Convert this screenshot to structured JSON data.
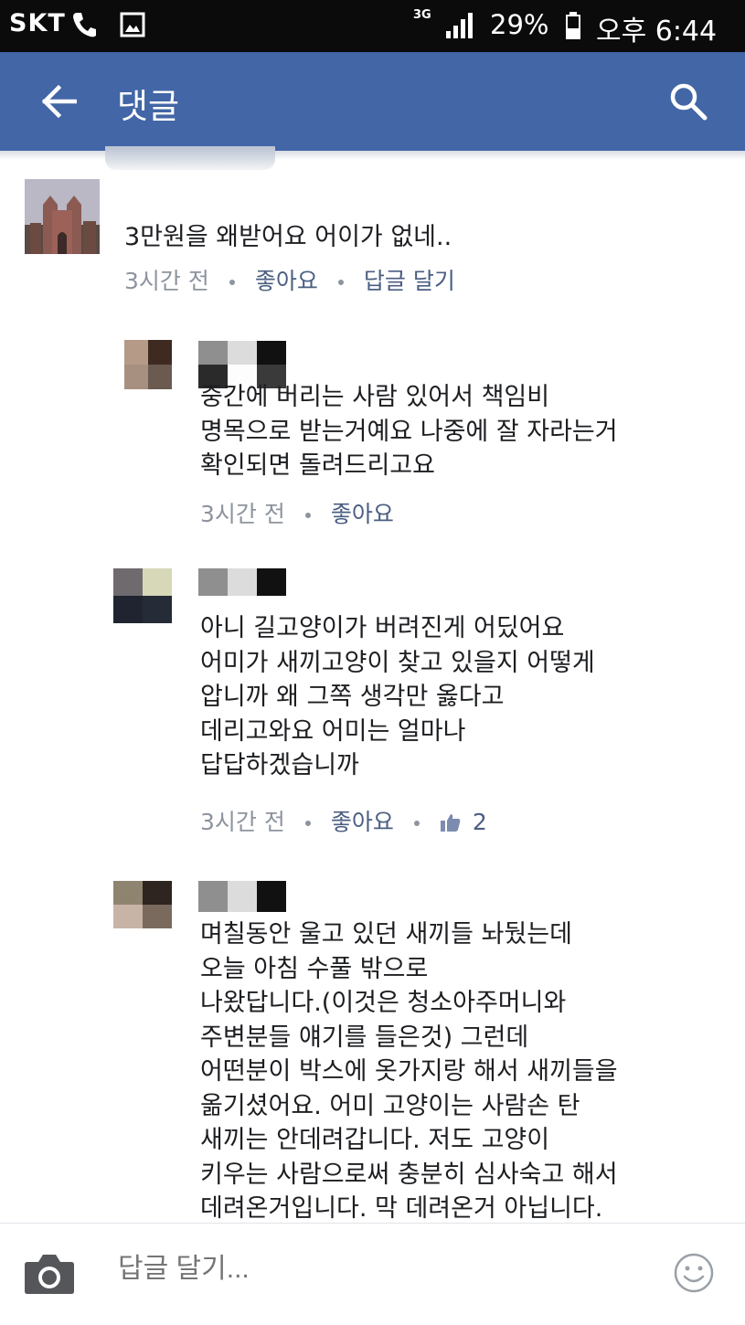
{
  "status_bar": {
    "carrier": "SKT",
    "network": "3G",
    "battery_percent": "29%",
    "time": "오후 6:44",
    "icons": [
      "phone-icon",
      "gallery-icon",
      "signal-icon",
      "battery-icon"
    ]
  },
  "app_bar": {
    "title": "댓글",
    "back_icon": "back-arrow-icon",
    "search_icon": "search-icon",
    "background": "#4266a6"
  },
  "comments": [
    {
      "text": "3만원을 왜받어요 어이가 없네..",
      "time": "3시간 전",
      "like_label": "좋아요",
      "reply_label": "답글 달기"
    },
    {
      "text": "중간에 버리는 사람 있어서 책임비\n명목으로 받는거예요 나중에 잘 자라는거\n확인되면 돌려드리고요",
      "time": "3시간 전",
      "like_label": "좋아요"
    },
    {
      "text": "아니 길고양이가 버려진게 어딨어요\n어미가 새끼고양이 찾고 있을지 어떻게\n압니까 왜 그쪽 생각만 옳다고\n데리고와요 어미는 얼마나\n답답하겠습니까",
      "time": "3시간 전",
      "like_label": "좋아요",
      "like_count": "2"
    },
    {
      "text": "며칠동안 울고 있던 새끼들 놔뒀는데\n오늘 아침 수풀 밖으로\n나왔답니다.(이것은 청소아주머니와\n주변분들 얘기를 들은것) 그런데\n어떤분이 박스에 옷가지랑 해서 새끼들을\n옮기셨어요. 어미 고양이는 사람손 탄\n새끼는 안데려갑니다. 저도 고양이\n키우는 사람으로써 충분히 심사숙고 해서\n데려온거입니다. 막 데려온거 아닙니다."
    }
  ],
  "composer": {
    "placeholder": "답글 달기...",
    "camera_icon": "camera-icon",
    "emoji_icon": "smiley-icon"
  },
  "colors": {
    "link": "#4b5e82",
    "meta": "#8d949e",
    "text": "#1c1e21"
  }
}
